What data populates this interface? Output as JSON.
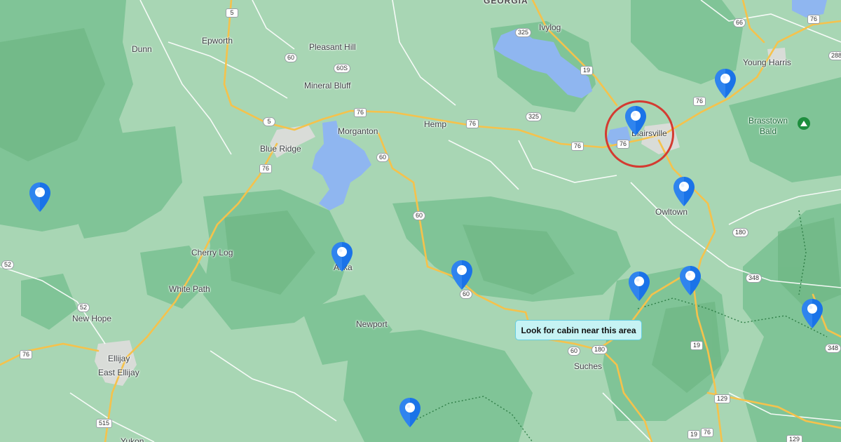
{
  "region_label": "GEORGIA",
  "places": [
    {
      "key": "dunn",
      "text": "Dunn"
    },
    {
      "key": "epworth",
      "text": "Epworth"
    },
    {
      "key": "pleasant-hill",
      "text": "Pleasant Hill"
    },
    {
      "key": "mineral-bluff",
      "text": "Mineral Bluff"
    },
    {
      "key": "ivylog",
      "text": "Ivylog"
    },
    {
      "key": "young-harris",
      "text": "Young Harris"
    },
    {
      "key": "morganton",
      "text": "Morganton"
    },
    {
      "key": "hemp",
      "text": "Hemp"
    },
    {
      "key": "blairsville",
      "text": "Blairsville"
    },
    {
      "key": "blue-ridge",
      "text": "Blue Ridge"
    },
    {
      "key": "owltown",
      "text": "Owltown"
    },
    {
      "key": "cherry-log",
      "text": "Cherry Log"
    },
    {
      "key": "aska",
      "text": "Aska"
    },
    {
      "key": "white-path",
      "text": "White Path"
    },
    {
      "key": "new-hope",
      "text": "New Hope"
    },
    {
      "key": "newport",
      "text": "Newport"
    },
    {
      "key": "suches",
      "text": "Suches"
    },
    {
      "key": "ellijay",
      "text": "Ellijay"
    },
    {
      "key": "east-ellijay",
      "text": "East Ellijay"
    },
    {
      "key": "yukon",
      "text": "Yukon"
    }
  ],
  "poi": {
    "name": "Brasstown\nBald",
    "icon": "peak-icon"
  },
  "shields": [
    "5",
    "66",
    "76",
    "325",
    "60",
    "60S",
    "76",
    "19",
    "5",
    "76",
    "76",
    "325",
    "76",
    "76",
    "60",
    "76",
    "60",
    "60",
    "180",
    "52",
    "52",
    "76",
    "60",
    "348",
    "180",
    "60",
    "19",
    "348",
    "129",
    "515",
    "129",
    "19",
    "76",
    "288"
  ],
  "callout_text": "Look for cabin near this area",
  "marker_icon": "map-pin-icon",
  "marker_count": 11,
  "colors": {
    "forest": "#7fc294",
    "land": "#a8d6b4",
    "water": "#8fb6f0",
    "highway": "#f5c24c",
    "pin": "#1a73e8",
    "highlight_circle": "#d43b31",
    "callout_bg": "#c6f3f4"
  }
}
